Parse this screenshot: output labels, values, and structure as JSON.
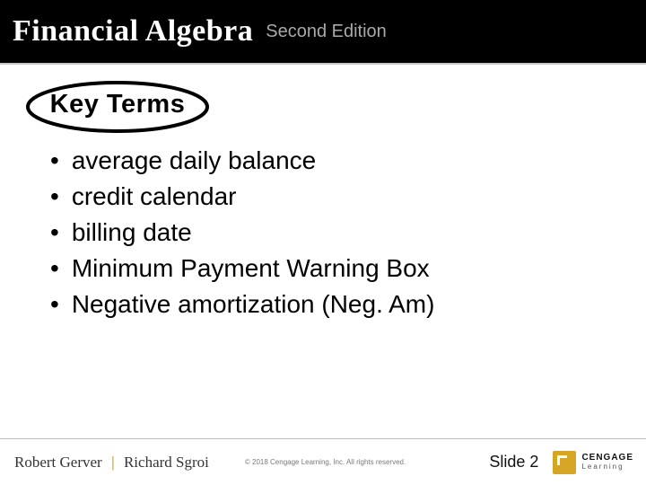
{
  "header": {
    "title_main": "Financial Algebra",
    "title_sub": "Second Edition"
  },
  "section": {
    "title": "Key Terms"
  },
  "terms": [
    "average daily balance",
    "credit calendar",
    "billing date",
    "Minimum Payment Warning Box",
    "Negative amortization (Neg. Am)"
  ],
  "footer": {
    "author1": "Robert Gerver",
    "separator": "|",
    "author2": "Richard Sgroi",
    "copyright": "© 2018 Cengage Learning, Inc. All rights reserved.",
    "slide_label": "Slide 2",
    "logo_line1": "CENGAGE",
    "logo_line2": "Learning"
  }
}
